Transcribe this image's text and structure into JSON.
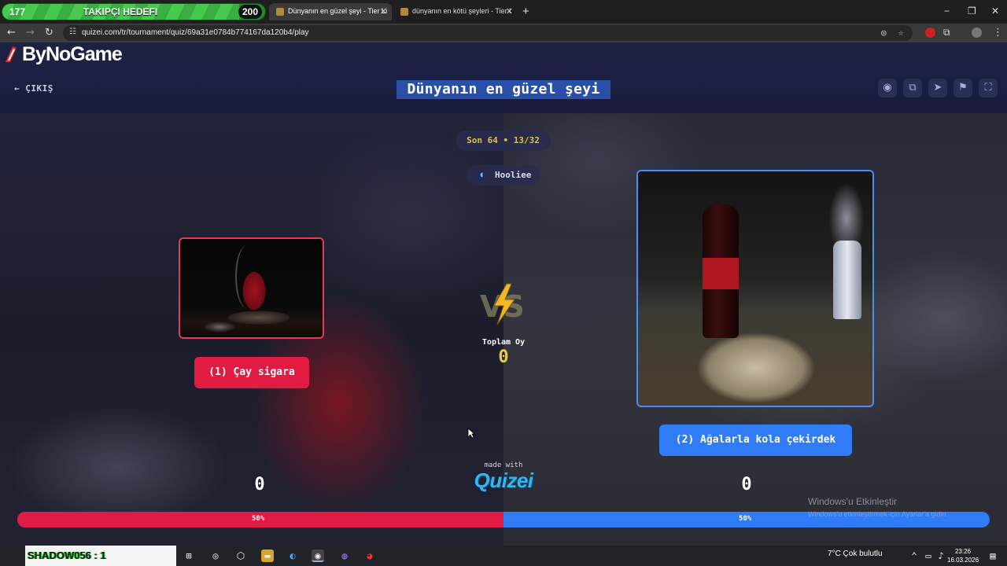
{
  "overlay": {
    "left_count": "177",
    "title": "TAKIPÇI HEDEFI",
    "target": "200",
    "fill_fraction": 0.9
  },
  "tabs": [
    {
      "title": "Dünyanın en güzel şeyi - Tier Li",
      "active": true
    },
    {
      "title": "dünyanın en kötü şeyleri - Tier l",
      "active": false
    }
  ],
  "window": {
    "minimize": "−",
    "restore": "❐",
    "close": "✕"
  },
  "browser": {
    "url": "quizei.com/tr/tournament/quiz/69a31e0784b774167da120b4/play"
  },
  "branding": {
    "logo": "ByNoGame"
  },
  "header": {
    "exit_label": "ÇIKIŞ",
    "title": "Dünyanın en güzel şeyi"
  },
  "round": {
    "label": "Son 64 • 13/32"
  },
  "creator": {
    "name": "Hooliee"
  },
  "choices": [
    {
      "label": "(1) Çay sigara",
      "votes": "0",
      "percent": "50%",
      "color": "#e21b43"
    },
    {
      "label": "(2) Ağalarla kola çekirdek",
      "votes": "0",
      "percent": "50%",
      "color": "#2f7cf6"
    }
  ],
  "totals": {
    "label": "Toplam Oy",
    "value": "0"
  },
  "footer": {
    "made_with": "made with",
    "brand": "Quizei"
  },
  "progress": {
    "left_fraction": 0.5
  },
  "watermark": {
    "line1": "Windows'u Etkinleştir",
    "line2": "Windows'u etkinleştirmek için Ayarlar'a gidin."
  },
  "taskbar": {
    "overlay_text": "SHADOW056 : 1",
    "weather": "7°C  Çok bulutlu",
    "time": "23:26",
    "date": "16.03.2026"
  }
}
